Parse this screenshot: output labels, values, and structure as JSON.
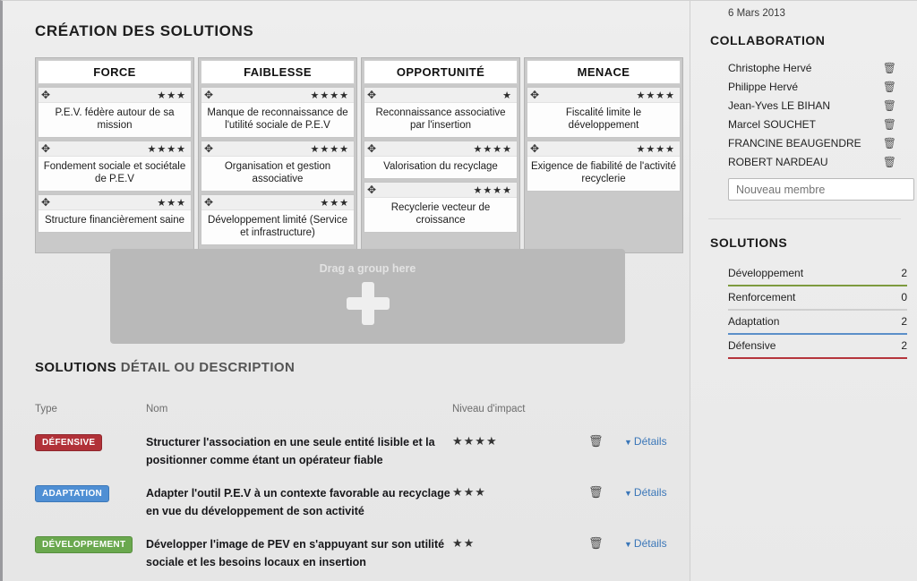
{
  "page": {
    "title": "CRÉATION DES SOLUTIONS"
  },
  "swot": {
    "columns": [
      {
        "header": "FORCE",
        "cards": [
          {
            "stars": "★★★",
            "text": "P.E.V. fédère autour de sa mission"
          },
          {
            "stars": "★★★★",
            "text": "Fondement sociale et sociétale de P.E.V"
          },
          {
            "stars": "★★★",
            "text": "Structure financièrement saine"
          }
        ]
      },
      {
        "header": "FAIBLESSE",
        "cards": [
          {
            "stars": "★★★★",
            "text": "Manque de reconnaissance de l'utilité sociale de P.E.V"
          },
          {
            "stars": "★★★★",
            "text": "Organisation et gestion associative"
          },
          {
            "stars": "★★★",
            "text": "Développement limité (Service et infrastructure)"
          }
        ]
      },
      {
        "header": "OPPORTUNITÉ",
        "cards": [
          {
            "stars": "★",
            "text": "Reconnaissance associative par l'insertion"
          },
          {
            "stars": "★★★★",
            "text": "Valorisation du recyclage"
          },
          {
            "stars": "★★★★",
            "text": "Recyclerie vecteur de croissance"
          }
        ]
      },
      {
        "header": "MENACE",
        "cards": [
          {
            "stars": "★★★★",
            "text": "Fiscalité limite le développement"
          },
          {
            "stars": "★★★★",
            "text": "Exigence de fiabilité de l'activité recyclerie"
          }
        ]
      }
    ],
    "move_icon": "✥"
  },
  "dropzone": {
    "label": "Drag a group here",
    "icon": "plus-icon"
  },
  "solutions_detail": {
    "title_bold": "SOLUTIONS",
    "title_rest": "DÉTAIL OU DESCRIPTION",
    "headers": {
      "type": "Type",
      "nom": "Nom",
      "niveau": "Niveau d'impact"
    },
    "details_label": "Détails",
    "caret": "▼",
    "trash_icon": "🗑",
    "rows": [
      {
        "type": "DÉFENSIVE",
        "type_class": "defensive",
        "name": "Structurer l'association en une seule entité lisible et la positionner comme étant un opérateur fiable",
        "stars": "★★★★"
      },
      {
        "type": "ADAPTATION",
        "type_class": "adaptation",
        "name": "Adapter l'outil P.E.V à un contexte favorable au recyclage en vue du développement de son activité",
        "stars": "★★★"
      },
      {
        "type": "DÉVELOPPEMENT",
        "type_class": "developpement",
        "name": "Développer l'image de PEV en s'appuyant sur son utilité sociale et les besoins locaux en insertion",
        "stars": "★★"
      }
    ]
  },
  "sidebar": {
    "date": "6 Mars 2013",
    "collaboration_title": "COLLABORATION",
    "members": [
      {
        "name": "Christophe Hervé"
      },
      {
        "name": "Philippe Hervé"
      },
      {
        "name": "Jean-Yves LE BIHAN"
      },
      {
        "name": "Marcel SOUCHET"
      },
      {
        "name": "FRANCINE BEAUGENDRE"
      },
      {
        "name": "ROBERT NARDEAU"
      }
    ],
    "new_member_placeholder": "Nouveau membre",
    "new_member_value": "",
    "trash_icon": "🗑",
    "solutions_title": "SOLUTIONS",
    "solution_stats": [
      {
        "label": "Développement",
        "count": "2",
        "color": "#7d9a3e"
      },
      {
        "label": "Renforcement",
        "count": "0",
        "color": "#cfcfcf"
      },
      {
        "label": "Adaptation",
        "count": "2",
        "color": "#5b8fc9"
      },
      {
        "label": "Défensive",
        "count": "2",
        "color": "#b5353c"
      }
    ]
  }
}
